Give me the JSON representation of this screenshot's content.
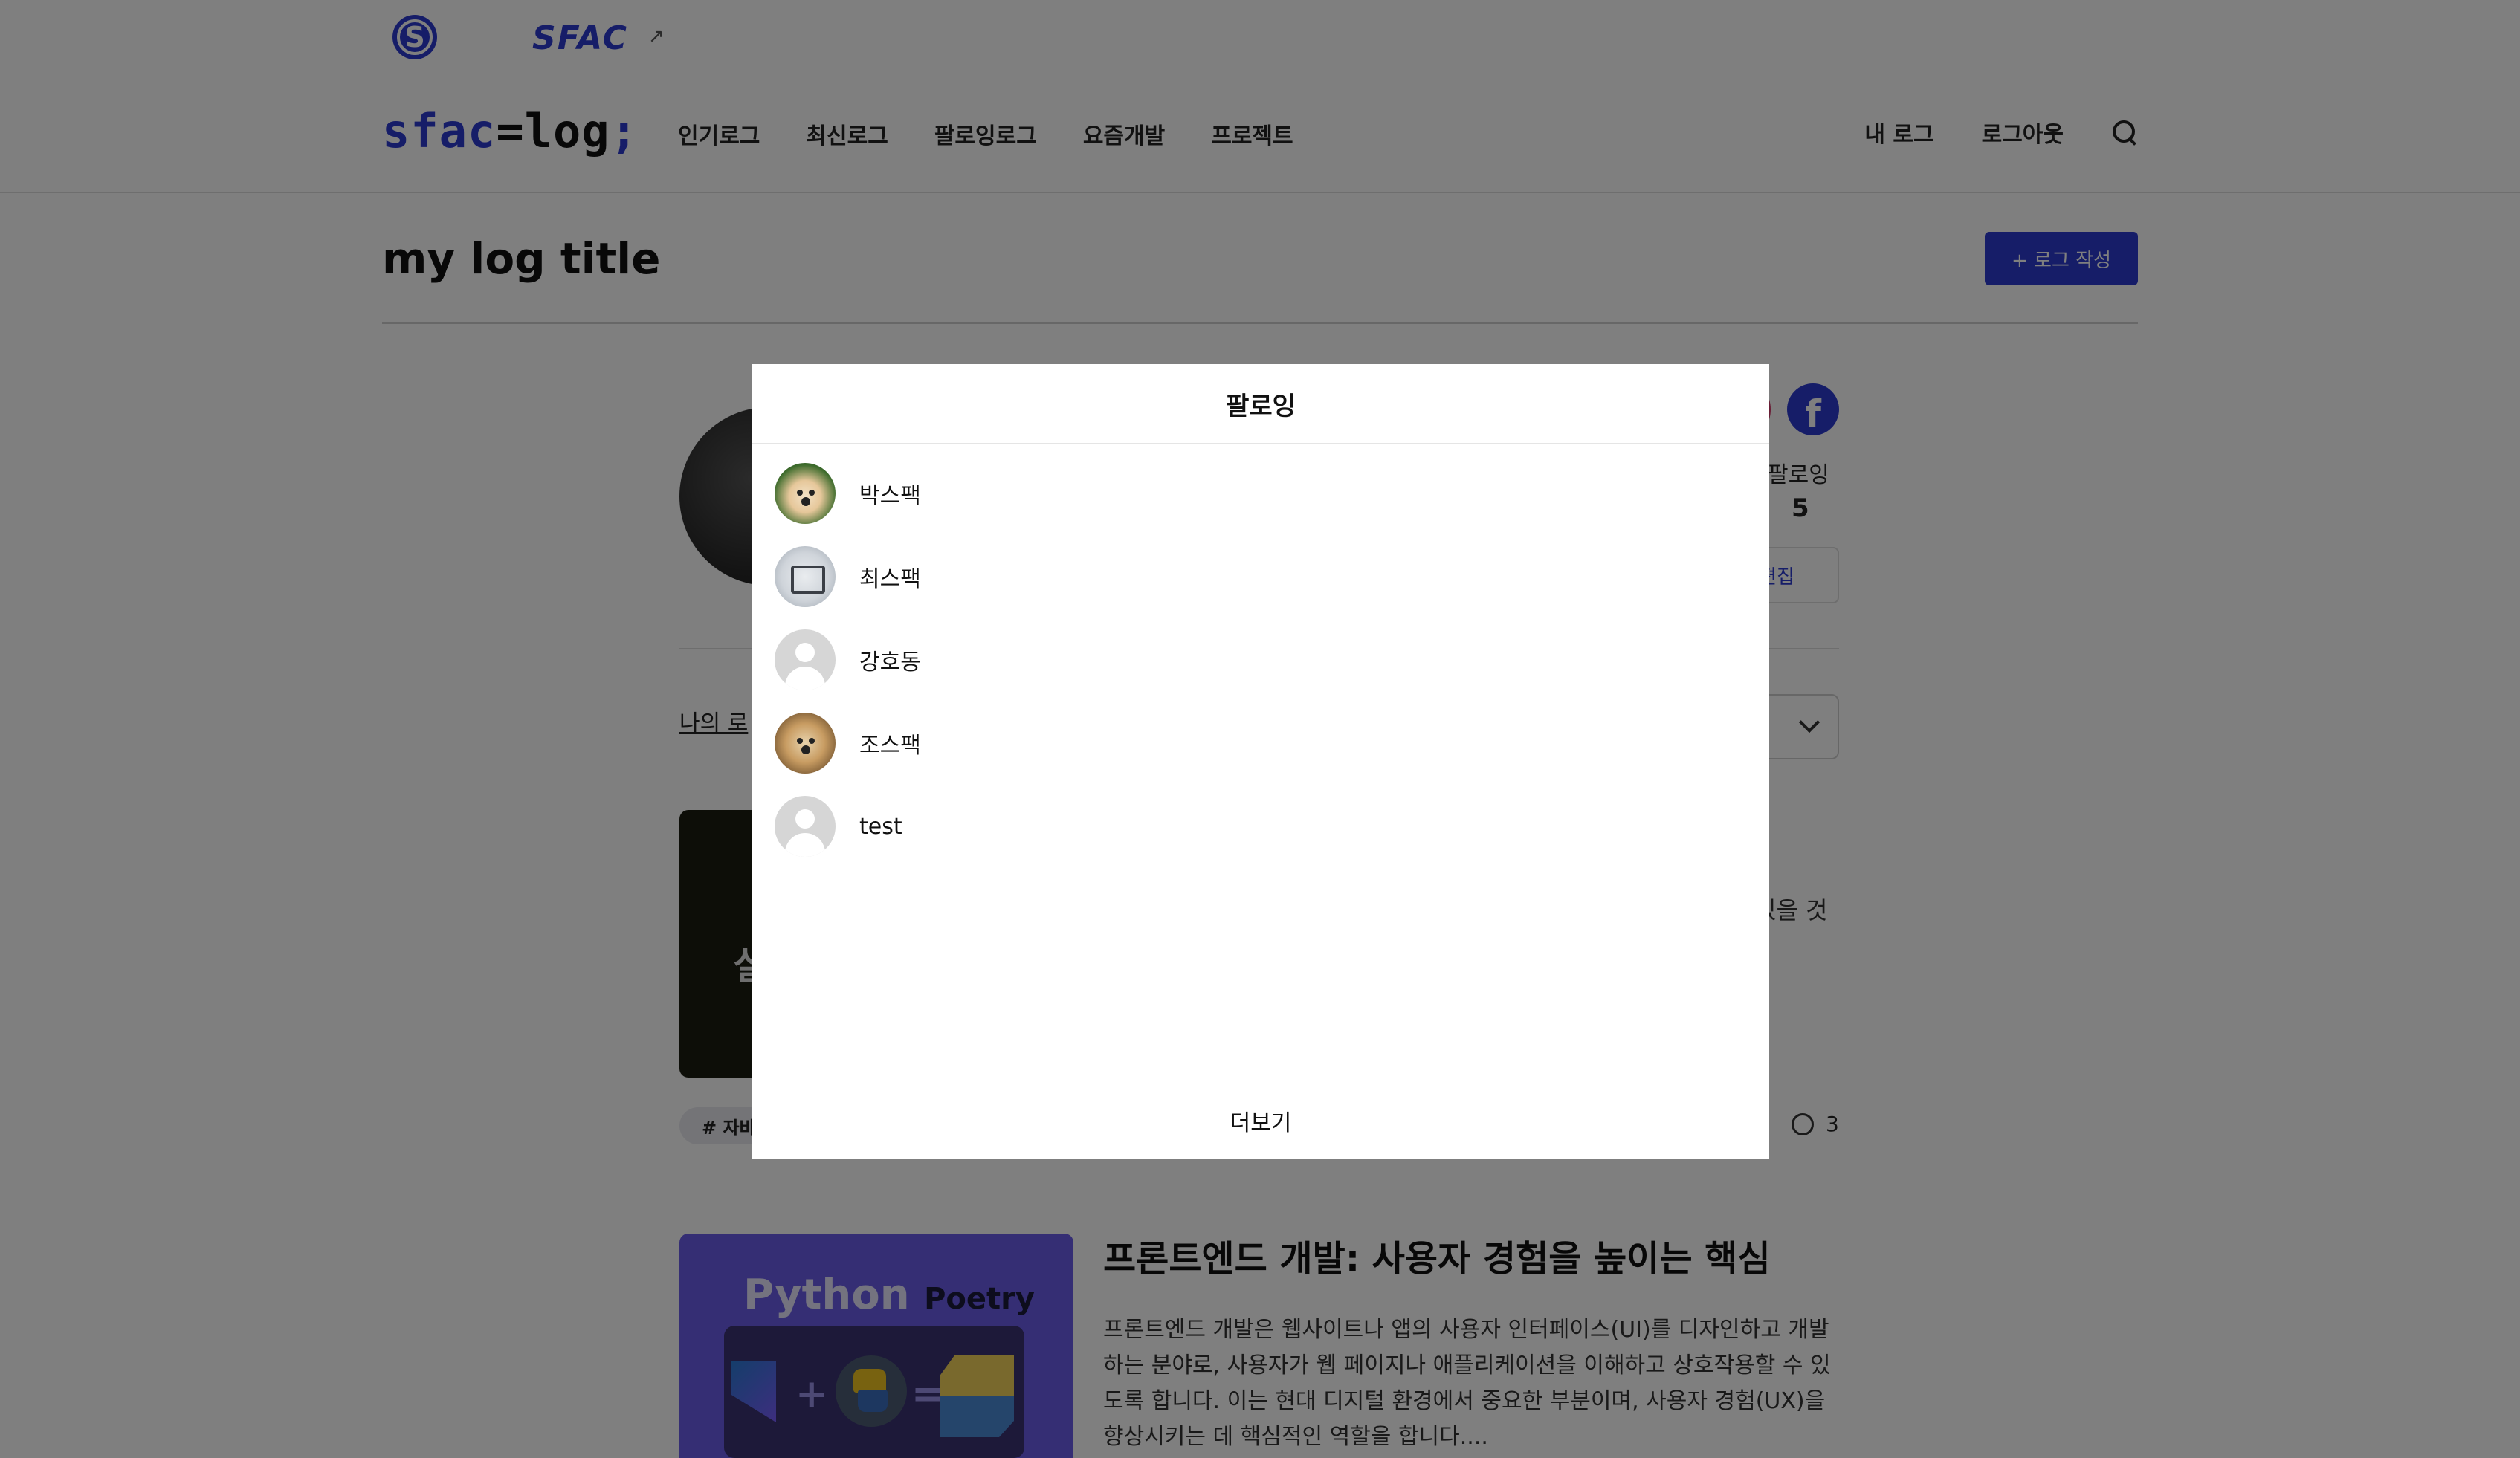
{
  "brand": {
    "s_logo": "S",
    "sfac_logo": "SFAC",
    "external_icon": "arrow-up-right"
  },
  "nav": {
    "logo_prefix": "sfac",
    "logo_eq": "=",
    "logo_mid": "log",
    "logo_suffix": ";",
    "links": [
      "인기로그",
      "최신로그",
      "팔로잉로그",
      "요즘개발",
      "프로젝트"
    ],
    "my_log": "내 로그",
    "logout": "로그아웃"
  },
  "header": {
    "title": "my log title",
    "write_button": "+ 로그 작성"
  },
  "profile": {
    "following_label": "팔로잉",
    "following_count": "5",
    "edit_button_partial": "편집",
    "tab_partial": "나의 로"
  },
  "cards": [
    {
      "thumb_text_partial": "실",
      "excerpt_partial": "있을 것",
      "tag_partial": "# 자바",
      "comments": "3"
    },
    {
      "thumb_title": "Python",
      "thumb_title_suffix": "Poetry",
      "thumb_plus": "+",
      "thumb_equals": "=",
      "title": "프론트엔드 개발: 사용자 경험을 높이는 핵심",
      "body": "프론트엔드 개발은 웹사이트나 앱의 사용자 인터페이스(UI)를 디자인하고 개발하는 분야로, 사용자가 웹 페이지나 애플리케이션을 이해하고 상호작용할 수 있도록 합니다. 이는 현대 디지털 환경에서 중요한 부분이며, 사용자 경험(UX)을 향상시키는 데 핵심적인 역할을 합니다...."
    }
  ],
  "modal": {
    "title": "팔로잉",
    "users": [
      {
        "name": "박스팩",
        "avatar": "dog-photo"
      },
      {
        "name": "최스팩",
        "avatar": "robot-photo"
      },
      {
        "name": "강호동",
        "avatar": "default-avatar"
      },
      {
        "name": "조스팩",
        "avatar": "dog-photo"
      },
      {
        "name": "test",
        "avatar": "default-avatar"
      }
    ],
    "more": "더보기"
  },
  "colors": {
    "accent": "#2c3bd1",
    "overlay": "rgba(0,0,0,0.5)"
  }
}
